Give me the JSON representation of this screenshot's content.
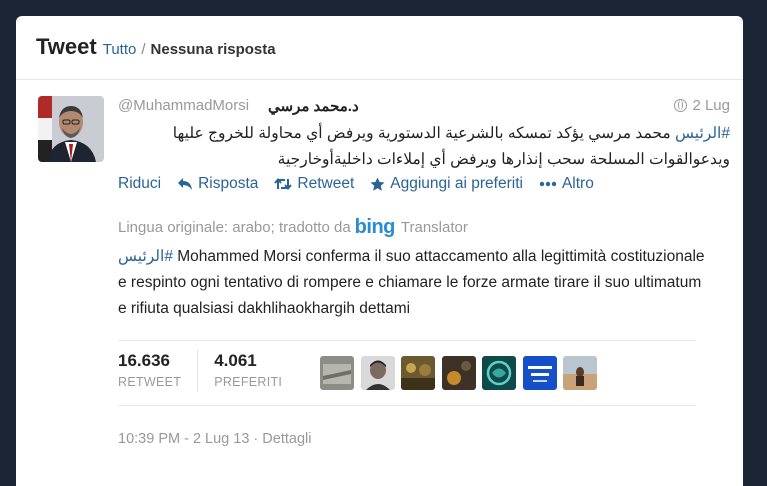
{
  "header": {
    "title": "Tweet",
    "filter_all": "Tutto",
    "separator": "/",
    "filter_current": "Nessuna risposta"
  },
  "tweet": {
    "handle": "@MuhammadMorsi",
    "fullname": "د.محمد مرسي",
    "time_short": "2 Lug",
    "hashtag": "#الرئيس",
    "text_line1_rest": " محمد مرسي يؤكد تمسكه بالشرعية الدستورية ويرفض أي محاولة للخروج عليها",
    "text_line2": "ويدعوالقوات المسلحة سحب إنذارها ويرفض أي إملاءات داخليةأوخارجية"
  },
  "actions": {
    "collapse": "Riduci",
    "reply": "Risposta",
    "retweet": "Retweet",
    "favorite": "Aggiungi ai preferiti",
    "more": "Altro"
  },
  "translation": {
    "source_label": "Lingua originale: arabo; tradotto da",
    "provider_logo": "bing",
    "provider_suffix": "Translator",
    "hashtag": "#الرئيس",
    "text": " Mohammed Morsi conferma il suo attaccamento alla legittimità costituzionale e respinto ogni tentativo di rompere e chiamare le forze armate tirare il suo ultimatum e rifiuta qualsiasi dakhlihaokhargih dettami"
  },
  "stats": {
    "retweets_count": "16.636",
    "retweets_label": "RETWEET",
    "favorites_count": "4.061",
    "favorites_label": "PREFERITI"
  },
  "meta": {
    "timestamp": "10:39 PM - 2 Lug 13",
    "dot": " · ",
    "details": "Dettagli"
  },
  "colors": {
    "background": "#1c2535",
    "link": "#2a6496",
    "muted": "#999999"
  },
  "icons": [
    "globe-icon",
    "reply-icon",
    "retweet-icon",
    "star-icon",
    "more-dots-icon",
    "bing-logo"
  ]
}
